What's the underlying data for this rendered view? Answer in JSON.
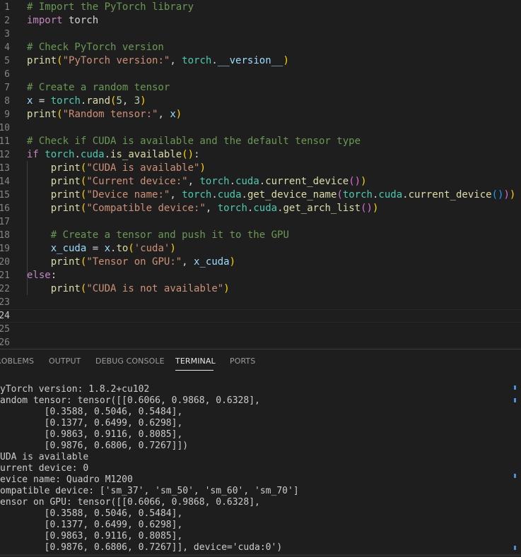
{
  "editor": {
    "line_numbers": [
      "1",
      "2",
      "3",
      "4",
      "5",
      "6",
      "7",
      "8",
      "9",
      "10",
      "11",
      "12",
      "13",
      "14",
      "15",
      "16",
      "17",
      "18",
      "19",
      "20",
      "21",
      "22",
      "23",
      "24",
      "25",
      "26"
    ],
    "current_line": "24",
    "lines": [
      {
        "tokens": [
          {
            "t": "# Import the PyTorch library",
            "c": "c"
          }
        ]
      },
      {
        "tokens": [
          {
            "t": "import",
            "c": "k"
          },
          {
            "t": " torch",
            "c": "p"
          }
        ]
      },
      {
        "tokens": []
      },
      {
        "tokens": [
          {
            "t": "# Check PyTorch version",
            "c": "c"
          }
        ]
      },
      {
        "tokens": [
          {
            "t": "print",
            "c": "f"
          },
          {
            "t": "(",
            "c": "b1"
          },
          {
            "t": "\"PyTorch version:\"",
            "c": "s"
          },
          {
            "t": ", ",
            "c": "p"
          },
          {
            "t": "torch",
            "c": "n"
          },
          {
            "t": ".",
            "c": "p"
          },
          {
            "t": "__version__",
            "c": "v"
          },
          {
            "t": ")",
            "c": "b1"
          }
        ]
      },
      {
        "tokens": []
      },
      {
        "tokens": [
          {
            "t": "# Create a random tensor",
            "c": "c"
          }
        ]
      },
      {
        "tokens": [
          {
            "t": "x",
            "c": "v"
          },
          {
            "t": " = ",
            "c": "p"
          },
          {
            "t": "torch",
            "c": "n"
          },
          {
            "t": ".",
            "c": "p"
          },
          {
            "t": "rand",
            "c": "f"
          },
          {
            "t": "(",
            "c": "b1"
          },
          {
            "t": "5",
            "c": "num"
          },
          {
            "t": ", ",
            "c": "p"
          },
          {
            "t": "3",
            "c": "num"
          },
          {
            "t": ")",
            "c": "b1"
          }
        ]
      },
      {
        "tokens": [
          {
            "t": "print",
            "c": "f"
          },
          {
            "t": "(",
            "c": "b1"
          },
          {
            "t": "\"Random tensor:\"",
            "c": "s"
          },
          {
            "t": ", ",
            "c": "p"
          },
          {
            "t": "x",
            "c": "v"
          },
          {
            "t": ")",
            "c": "b1"
          }
        ]
      },
      {
        "tokens": []
      },
      {
        "tokens": [
          {
            "t": "# Check if CUDA is available and the default tensor type",
            "c": "c"
          }
        ]
      },
      {
        "tokens": [
          {
            "t": "if",
            "c": "k"
          },
          {
            "t": " ",
            "c": "p"
          },
          {
            "t": "torch",
            "c": "n"
          },
          {
            "t": ".",
            "c": "p"
          },
          {
            "t": "cuda",
            "c": "n"
          },
          {
            "t": ".",
            "c": "p"
          },
          {
            "t": "is_available",
            "c": "f"
          },
          {
            "t": "()",
            "c": "b1"
          },
          {
            "t": ":",
            "c": "p"
          }
        ]
      },
      {
        "tokens": [
          {
            "t": "    ",
            "c": "p"
          },
          {
            "t": "print",
            "c": "f"
          },
          {
            "t": "(",
            "c": "b1"
          },
          {
            "t": "\"CUDA is available\"",
            "c": "s"
          },
          {
            "t": ")",
            "c": "b1"
          }
        ]
      },
      {
        "tokens": [
          {
            "t": "    ",
            "c": "p"
          },
          {
            "t": "print",
            "c": "f"
          },
          {
            "t": "(",
            "c": "b1"
          },
          {
            "t": "\"Current device:\"",
            "c": "s"
          },
          {
            "t": ", ",
            "c": "p"
          },
          {
            "t": "torch",
            "c": "n"
          },
          {
            "t": ".",
            "c": "p"
          },
          {
            "t": "cuda",
            "c": "n"
          },
          {
            "t": ".",
            "c": "p"
          },
          {
            "t": "current_device",
            "c": "f"
          },
          {
            "t": "()",
            "c": "b2"
          },
          {
            "t": ")",
            "c": "b1"
          }
        ]
      },
      {
        "tokens": [
          {
            "t": "    ",
            "c": "p"
          },
          {
            "t": "print",
            "c": "f"
          },
          {
            "t": "(",
            "c": "b1"
          },
          {
            "t": "\"Device name:\"",
            "c": "s"
          },
          {
            "t": ", ",
            "c": "p"
          },
          {
            "t": "torch",
            "c": "n"
          },
          {
            "t": ".",
            "c": "p"
          },
          {
            "t": "cuda",
            "c": "n"
          },
          {
            "t": ".",
            "c": "p"
          },
          {
            "t": "get_device_name",
            "c": "f"
          },
          {
            "t": "(",
            "c": "b2"
          },
          {
            "t": "torch",
            "c": "n"
          },
          {
            "t": ".",
            "c": "p"
          },
          {
            "t": "cuda",
            "c": "n"
          },
          {
            "t": ".",
            "c": "p"
          },
          {
            "t": "current_device",
            "c": "f"
          },
          {
            "t": "()",
            "c": "b3"
          },
          {
            "t": ")",
            "c": "b2"
          },
          {
            "t": ")",
            "c": "b1"
          }
        ]
      },
      {
        "tokens": [
          {
            "t": "    ",
            "c": "p"
          },
          {
            "t": "print",
            "c": "f"
          },
          {
            "t": "(",
            "c": "b1"
          },
          {
            "t": "\"Compatible device:\"",
            "c": "s"
          },
          {
            "t": ", ",
            "c": "p"
          },
          {
            "t": "torch",
            "c": "n"
          },
          {
            "t": ".",
            "c": "p"
          },
          {
            "t": "cuda",
            "c": "n"
          },
          {
            "t": ".",
            "c": "p"
          },
          {
            "t": "get_arch_list",
            "c": "f"
          },
          {
            "t": "()",
            "c": "b2"
          },
          {
            "t": ")",
            "c": "b1"
          }
        ]
      },
      {
        "tokens": []
      },
      {
        "tokens": [
          {
            "t": "    ",
            "c": "p"
          },
          {
            "t": "# Create a tensor and push it to the GPU",
            "c": "c"
          }
        ]
      },
      {
        "tokens": [
          {
            "t": "    ",
            "c": "p"
          },
          {
            "t": "x_cuda",
            "c": "v"
          },
          {
            "t": " = ",
            "c": "p"
          },
          {
            "t": "x",
            "c": "v"
          },
          {
            "t": ".",
            "c": "p"
          },
          {
            "t": "to",
            "c": "f"
          },
          {
            "t": "(",
            "c": "b1"
          },
          {
            "t": "'cuda'",
            "c": "s"
          },
          {
            "t": ")",
            "c": "b1"
          }
        ]
      },
      {
        "tokens": [
          {
            "t": "    ",
            "c": "p"
          },
          {
            "t": "print",
            "c": "f"
          },
          {
            "t": "(",
            "c": "b1"
          },
          {
            "t": "\"Tensor on GPU:\"",
            "c": "s"
          },
          {
            "t": ", ",
            "c": "p"
          },
          {
            "t": "x_cuda",
            "c": "v"
          },
          {
            "t": ")",
            "c": "b1"
          }
        ]
      },
      {
        "tokens": [
          {
            "t": "else",
            "c": "k"
          },
          {
            "t": ":",
            "c": "p"
          }
        ]
      },
      {
        "tokens": [
          {
            "t": "    ",
            "c": "p"
          },
          {
            "t": "print",
            "c": "f"
          },
          {
            "t": "(",
            "c": "b1"
          },
          {
            "t": "\"CUDA is not available\"",
            "c": "s"
          },
          {
            "t": ")",
            "c": "b1"
          }
        ]
      },
      {
        "tokens": []
      },
      {
        "tokens": []
      },
      {
        "tokens": []
      },
      {
        "tokens": []
      }
    ]
  },
  "panel": {
    "tabs": [
      {
        "label": "ROBLEMS",
        "active": false
      },
      {
        "label": "OUTPUT",
        "active": false
      },
      {
        "label": "DEBUG CONSOLE",
        "active": false
      },
      {
        "label": "TERMINAL",
        "active": true
      },
      {
        "label": "PORTS",
        "active": false
      }
    ],
    "terminal_lines": [
      "yTorch version: 1.8.2+cu102",
      "andom tensor: tensor([[0.6066, 0.9868, 0.6328],",
      "        [0.3588, 0.5046, 0.5484],",
      "        [0.1377, 0.6499, 0.6298],",
      "        [0.9863, 0.9116, 0.8085],",
      "        [0.9876, 0.6806, 0.7267]])",
      "UDA is available",
      "urrent device: 0",
      "evice name: Quadro M1200",
      "ompatible device: ['sm_37', 'sm_50', 'sm_60', 'sm_70']",
      "ensor on GPU: tensor([[0.6066, 0.9868, 0.6328],",
      "        [0.3588, 0.5046, 0.5484],",
      "        [0.1377, 0.6499, 0.6298],",
      "        [0.9863, 0.9116, 0.8085],",
      "        [0.9876, 0.6806, 0.7267]], device='cuda:0')"
    ]
  },
  "colors": {
    "background": "#1e1e1e",
    "comment": "#6a9955",
    "keyword": "#c586c0",
    "function": "#dcdcaa",
    "string": "#ce9178",
    "module": "#4ec9b0",
    "variable": "#9cdcfe",
    "number": "#b5cea8",
    "terminal_text": "#cccccc",
    "scroll_marker": "#4b91d6"
  }
}
